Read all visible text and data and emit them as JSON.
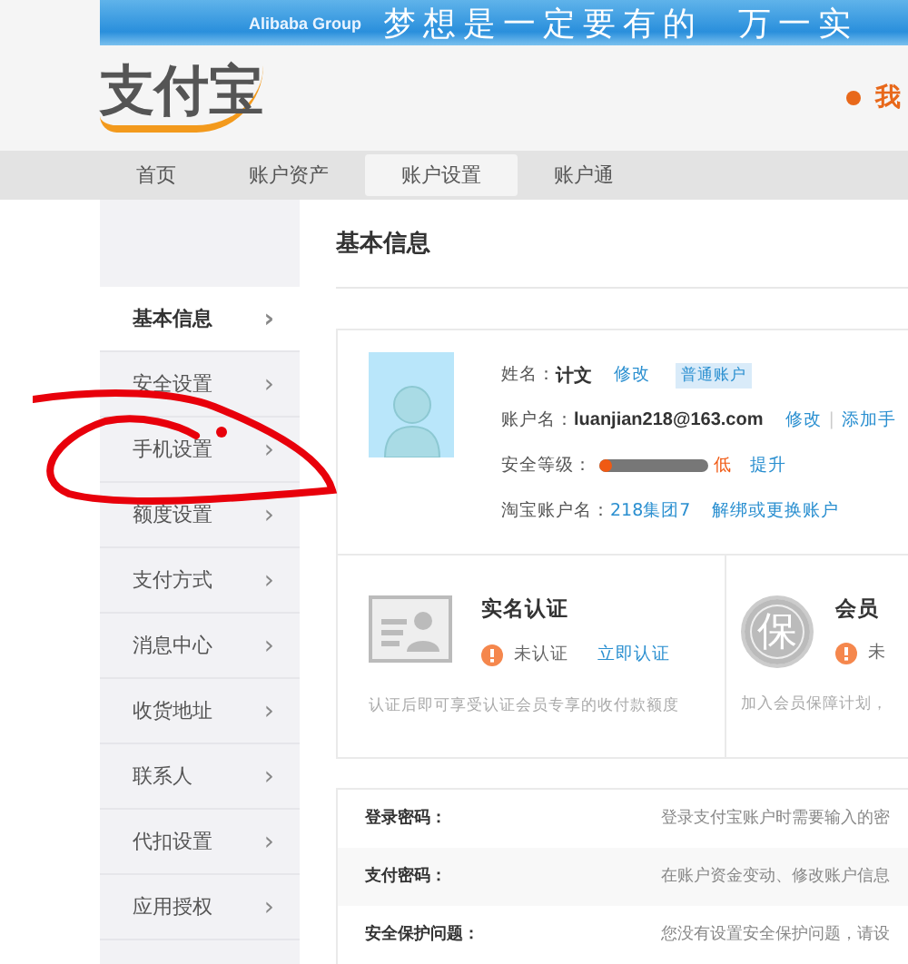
{
  "banner": {
    "brand": "Alibaba Group",
    "slogan": "梦想是一定要有的  万一实"
  },
  "header": {
    "logo": "支付宝",
    "link": "我"
  },
  "nav": [
    {
      "label": "首页",
      "selected": false
    },
    {
      "label": "账户资产",
      "selected": false
    },
    {
      "label": "账户设置",
      "selected": true
    },
    {
      "label": "账户通",
      "selected": false
    }
  ],
  "sidebar": [
    {
      "label": "基本信息",
      "selected": true,
      "arrow": "›"
    },
    {
      "label": "安全设置",
      "selected": false,
      "arrow": "›"
    },
    {
      "label": "手机设置",
      "selected": false,
      "arrow": "›"
    },
    {
      "label": "额度设置",
      "selected": false,
      "arrow": "›"
    },
    {
      "label": "支付方式",
      "selected": false,
      "arrow": "›"
    },
    {
      "label": "消息中心",
      "selected": false,
      "arrow": "›"
    },
    {
      "label": "收货地址",
      "selected": false,
      "arrow": "›"
    },
    {
      "label": "联系人",
      "selected": false,
      "arrow": "›"
    },
    {
      "label": "代扣设置",
      "selected": false,
      "arrow": "›"
    },
    {
      "label": "应用授权",
      "selected": false,
      "arrow": "›"
    }
  ],
  "title": "基本信息",
  "profile": {
    "name_label": "姓名：",
    "name": "计文",
    "name_edit": "修改",
    "account_type": "普通账户",
    "account_label": "账户名：",
    "account": "luanjian218@163.com",
    "account_edit": "修改",
    "account_sep": "|",
    "account_add": "添加手",
    "security_label": "安全等级：",
    "security": {
      "level": 0.12,
      "reading": "低",
      "action": "提升"
    },
    "taobao_label": "淘宝账户名：",
    "taobao": "218集团7",
    "taobao_action": "解绑或更换账户"
  },
  "cards": [
    {
      "kind": "idcard",
      "title": "实名认证",
      "status": "未认证",
      "action": "立即认证",
      "note": "认证后即可享受认证会员专享的收付款额度"
    },
    {
      "kind": "seal",
      "seal": "保",
      "title": "会员",
      "status": "未",
      "note": "加入会员保障计划，"
    }
  ],
  "settings": [
    {
      "label": "登录密码：",
      "text": "登录支付宝账户时需要输入的密"
    },
    {
      "label": "支付密码：",
      "text": "在账户资金变动、修改账户信息"
    },
    {
      "label": "安全保护问题：",
      "text": "您没有设置安全保护问题，请设"
    }
  ]
}
